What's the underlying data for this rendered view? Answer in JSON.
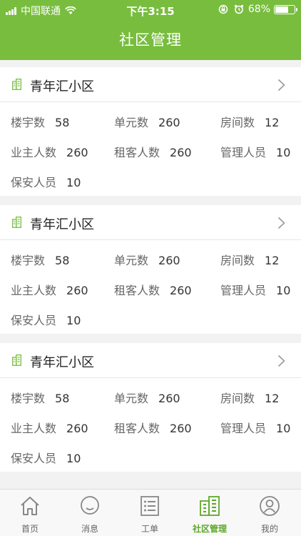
{
  "status_bar": {
    "carrier": "中国联通",
    "time": "下午3:15",
    "battery": "68%",
    "battery_level": 0.68
  },
  "header": {
    "title": "社区管理"
  },
  "communities": [
    {
      "name": "青年汇小区",
      "stats": [
        [
          {
            "label": "楼宇数",
            "value": "58"
          },
          {
            "label": "单元数",
            "value": "260"
          },
          {
            "label": "房间数",
            "value": "12"
          }
        ],
        [
          {
            "label": "业主人数",
            "value": "260"
          },
          {
            "label": "租客人数",
            "value": "260"
          },
          {
            "label": "管理人员",
            "value": "10"
          }
        ],
        [
          {
            "label": "保安人员",
            "value": "10"
          }
        ]
      ]
    },
    {
      "name": "青年汇小区",
      "stats": [
        [
          {
            "label": "楼宇数",
            "value": "58"
          },
          {
            "label": "单元数",
            "value": "260"
          },
          {
            "label": "房间数",
            "value": "12"
          }
        ],
        [
          {
            "label": "业主人数",
            "value": "260"
          },
          {
            "label": "租客人数",
            "value": "260"
          },
          {
            "label": "管理人员",
            "value": "10"
          }
        ],
        [
          {
            "label": "保安人员",
            "value": "10"
          }
        ]
      ]
    },
    {
      "name": "青年汇小区",
      "stats": [
        [
          {
            "label": "楼宇数",
            "value": "58"
          },
          {
            "label": "单元数",
            "value": "260"
          },
          {
            "label": "房间数",
            "value": "12"
          }
        ],
        [
          {
            "label": "业主人数",
            "value": "260"
          },
          {
            "label": "租客人数",
            "value": "260"
          },
          {
            "label": "管理人员",
            "value": "10"
          }
        ],
        [
          {
            "label": "保安人员",
            "value": "10"
          }
        ]
      ]
    }
  ],
  "tabs": [
    {
      "label": "首页",
      "icon": "home-icon",
      "active": false
    },
    {
      "label": "消息",
      "icon": "message-icon",
      "active": false
    },
    {
      "label": "工单",
      "icon": "work-order-icon",
      "active": false
    },
    {
      "label": "社区管理",
      "icon": "building-icon",
      "active": true
    },
    {
      "label": "我的",
      "icon": "profile-icon",
      "active": false
    }
  ],
  "colors": {
    "accent": "#78bd3e",
    "active_tab": "#5ea82b"
  }
}
